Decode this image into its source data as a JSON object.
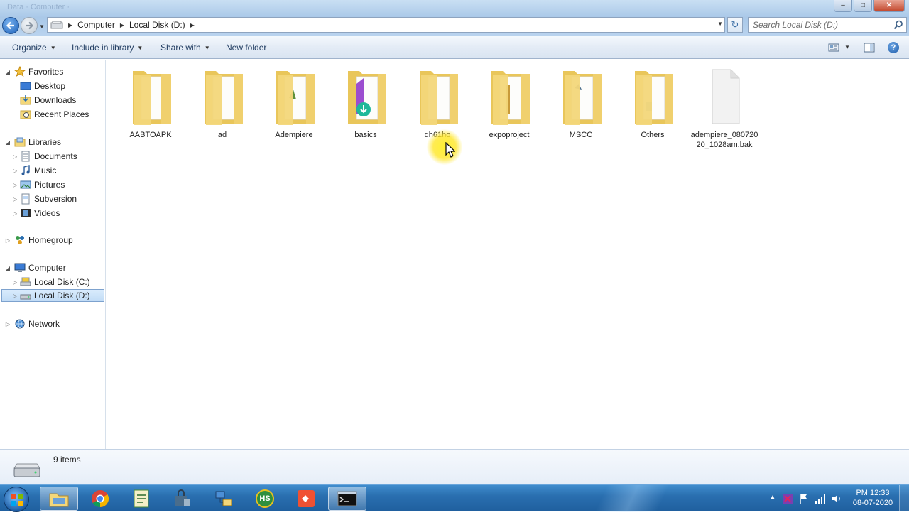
{
  "window": {
    "title_ghost": "Data  ·  Computer  ·"
  },
  "address": {
    "crumbs": [
      "Computer",
      "Local Disk (D:)"
    ]
  },
  "search": {
    "placeholder": "Search Local Disk (D:)"
  },
  "toolbar": {
    "organize": "Organize",
    "include_in_library": "Include in library",
    "share_with": "Share with",
    "new_folder": "New folder"
  },
  "nav": {
    "favorites": "Favorites",
    "favorites_items": [
      "Desktop",
      "Downloads",
      "Recent Places"
    ],
    "libraries": "Libraries",
    "libraries_items": [
      "Documents",
      "Music",
      "Pictures",
      "Subversion",
      "Videos"
    ],
    "homegroup": "Homegroup",
    "computer": "Computer",
    "computer_items": [
      "Local Disk (C:)",
      "Local Disk (D:)"
    ],
    "network": "Network"
  },
  "items": [
    {
      "name": "AABTOAPK",
      "type": "folder"
    },
    {
      "name": "ad",
      "type": "folder"
    },
    {
      "name": "Adempiere",
      "type": "folder"
    },
    {
      "name": "basics",
      "type": "folder"
    },
    {
      "name": "dh61ho",
      "type": "folder"
    },
    {
      "name": "expoproject",
      "type": "folder"
    },
    {
      "name": "MSCC",
      "type": "folder"
    },
    {
      "name": "Others",
      "type": "folder"
    },
    {
      "name": "adempiere_08072020_1028am.bak",
      "type": "file"
    }
  ],
  "status": {
    "count": "9 items"
  },
  "taskbar": {
    "clock_time": "PM 12:33",
    "clock_date": "08-07-2020",
    "hs_label": "HS"
  },
  "colors": {
    "accent": "#2a6fb0",
    "folder": "#f3d77a",
    "selection": "#c1dcf6"
  }
}
